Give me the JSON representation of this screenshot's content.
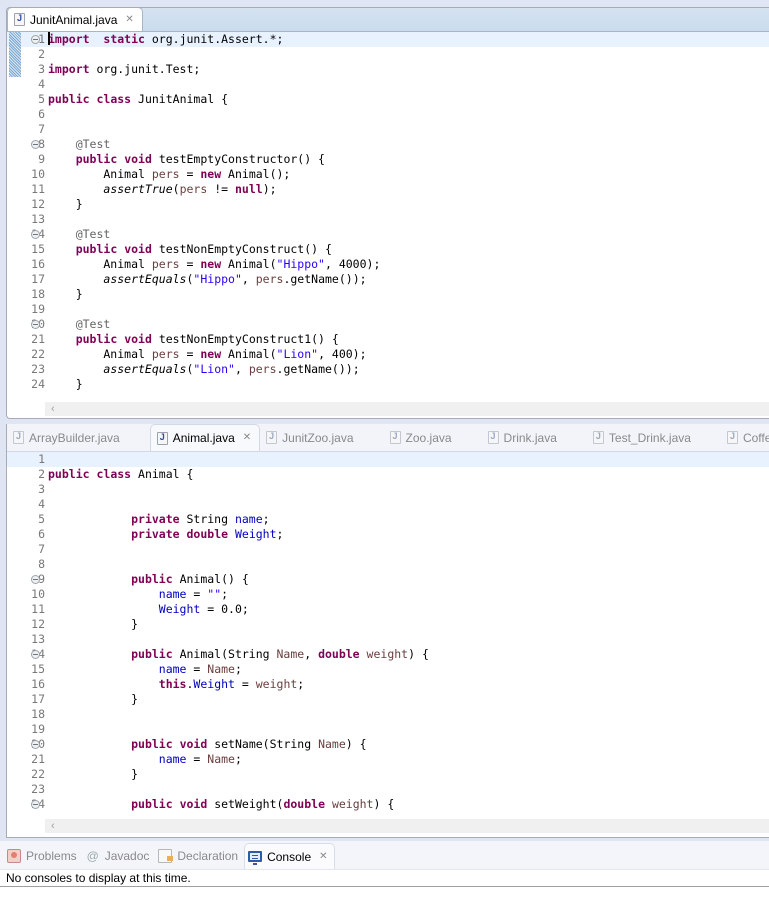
{
  "top_editor": {
    "tabs": [
      {
        "label": "JunitAnimal.java",
        "active": true,
        "closable": true
      }
    ],
    "current_line": 1,
    "lines": [
      {
        "n": "1",
        "fold": true,
        "tokens": [
          [
            "caret",
            ""
          ],
          [
            "kw",
            "import"
          ],
          [
            "",
            "  "
          ],
          [
            "kw",
            "static"
          ],
          [
            "",
            " org.junit.Assert.*;"
          ]
        ]
      },
      {
        "n": "2",
        "tokens": []
      },
      {
        "n": "3",
        "tokens": [
          [
            "kw",
            "import"
          ],
          [
            "",
            " org.junit.Test;"
          ]
        ]
      },
      {
        "n": "4",
        "tokens": []
      },
      {
        "n": "5",
        "tokens": [
          [
            "kw",
            "public"
          ],
          [
            "",
            " "
          ],
          [
            "kw",
            "class"
          ],
          [
            "",
            " JunitAnimal {"
          ]
        ]
      },
      {
        "n": "6",
        "tokens": []
      },
      {
        "n": "7",
        "tokens": []
      },
      {
        "n": "8",
        "fold": true,
        "tokens": [
          [
            "",
            "    "
          ],
          [
            "ann",
            "@Test"
          ]
        ]
      },
      {
        "n": "9",
        "tokens": [
          [
            "",
            "    "
          ],
          [
            "kw",
            "public"
          ],
          [
            "",
            " "
          ],
          [
            "kw",
            "void"
          ],
          [
            "",
            " testEmptyConstructor() {"
          ]
        ]
      },
      {
        "n": "10",
        "tokens": [
          [
            "",
            "        Animal "
          ],
          [
            "local",
            "pers"
          ],
          [
            "",
            " = "
          ],
          [
            "kw",
            "new"
          ],
          [
            "",
            " Animal();"
          ]
        ]
      },
      {
        "n": "11",
        "tokens": [
          [
            "",
            "        "
          ],
          [
            "ital",
            "assertTrue"
          ],
          [
            "",
            "("
          ],
          [
            "local",
            "pers"
          ],
          [
            "",
            " != "
          ],
          [
            "kw",
            "null"
          ],
          [
            "",
            ");"
          ]
        ]
      },
      {
        "n": "12",
        "tokens": [
          [
            "",
            "    }"
          ]
        ]
      },
      {
        "n": "13",
        "tokens": []
      },
      {
        "n": "14",
        "fold": true,
        "tokens": [
          [
            "",
            "    "
          ],
          [
            "ann",
            "@Test"
          ]
        ]
      },
      {
        "n": "15",
        "tokens": [
          [
            "",
            "    "
          ],
          [
            "kw",
            "public"
          ],
          [
            "",
            " "
          ],
          [
            "kw",
            "void"
          ],
          [
            "",
            " testNonEmptyConstruct() {"
          ]
        ]
      },
      {
        "n": "16",
        "tokens": [
          [
            "",
            "        Animal "
          ],
          [
            "local",
            "pers"
          ],
          [
            "",
            " = "
          ],
          [
            "kw",
            "new"
          ],
          [
            "",
            " Animal("
          ],
          [
            "str",
            "\"Hippo\""
          ],
          [
            "",
            ", 4000);"
          ]
        ]
      },
      {
        "n": "17",
        "tokens": [
          [
            "",
            "        "
          ],
          [
            "ital",
            "assertEquals"
          ],
          [
            "",
            "("
          ],
          [
            "str",
            "\"Hippo\""
          ],
          [
            "",
            ", "
          ],
          [
            "local",
            "pers"
          ],
          [
            "",
            ".getName());"
          ]
        ]
      },
      {
        "n": "18",
        "tokens": [
          [
            "",
            "    }"
          ]
        ]
      },
      {
        "n": "19",
        "tokens": []
      },
      {
        "n": "20",
        "fold": true,
        "tokens": [
          [
            "",
            "    "
          ],
          [
            "ann",
            "@Test"
          ]
        ]
      },
      {
        "n": "21",
        "tokens": [
          [
            "",
            "    "
          ],
          [
            "kw",
            "public"
          ],
          [
            "",
            " "
          ],
          [
            "kw",
            "void"
          ],
          [
            "",
            " testNonEmptyConstruct1() {"
          ]
        ]
      },
      {
        "n": "22",
        "tokens": [
          [
            "",
            "        Animal "
          ],
          [
            "local",
            "pers"
          ],
          [
            "",
            " = "
          ],
          [
            "kw",
            "new"
          ],
          [
            "",
            " Animal("
          ],
          [
            "str",
            "\"Lion\""
          ],
          [
            "",
            ", 400);"
          ]
        ]
      },
      {
        "n": "23",
        "tokens": [
          [
            "",
            "        "
          ],
          [
            "ital",
            "assertEquals"
          ],
          [
            "",
            "("
          ],
          [
            "str",
            "\"Lion\""
          ],
          [
            "",
            ", "
          ],
          [
            "local",
            "pers"
          ],
          [
            "",
            ".getName());"
          ]
        ]
      },
      {
        "n": "24",
        "tokens": [
          [
            "",
            "    }"
          ]
        ]
      }
    ],
    "scroll_left_icon": "‹"
  },
  "mid_editor": {
    "tabs": [
      {
        "label": "ArrayBuilder.java",
        "active": false
      },
      {
        "label": "Animal.java",
        "active": true,
        "closable": true
      },
      {
        "label": "JunitZoo.java",
        "active": false
      },
      {
        "label": "Zoo.java",
        "active": false
      },
      {
        "label": "Drink.java",
        "active": false
      },
      {
        "label": "Test_Drink.java",
        "active": false
      },
      {
        "label": "CoffeeSh",
        "active": false
      }
    ],
    "current_line": 1,
    "lines": [
      {
        "n": "1",
        "tokens": []
      },
      {
        "n": "2",
        "tokens": [
          [
            "kw",
            "public"
          ],
          [
            "",
            " "
          ],
          [
            "kw",
            "class"
          ],
          [
            "",
            " Animal {"
          ]
        ]
      },
      {
        "n": "3",
        "tokens": []
      },
      {
        "n": "4",
        "tokens": []
      },
      {
        "n": "5",
        "tokens": [
          [
            "",
            "            "
          ],
          [
            "kw",
            "private"
          ],
          [
            "",
            " String "
          ],
          [
            "field",
            "name"
          ],
          [
            ";"
          ]
        ]
      },
      {
        "n": "6",
        "tokens": [
          [
            "",
            "            "
          ],
          [
            "kw",
            "private"
          ],
          [
            "",
            " "
          ],
          [
            "kw",
            "double"
          ],
          [
            "",
            " "
          ],
          [
            "field",
            "Weight"
          ],
          [
            ";"
          ]
        ]
      },
      {
        "n": "7",
        "tokens": []
      },
      {
        "n": "8",
        "tokens": []
      },
      {
        "n": "9",
        "fold": true,
        "tokens": [
          [
            "",
            "            "
          ],
          [
            "kw",
            "public"
          ],
          [
            "",
            " Animal() {"
          ]
        ]
      },
      {
        "n": "10",
        "tokens": [
          [
            "",
            "                "
          ],
          [
            "field",
            "name"
          ],
          [
            "",
            " = "
          ],
          [
            "str",
            "\"\""
          ],
          [
            ";"
          ]
        ]
      },
      {
        "n": "11",
        "tokens": [
          [
            "",
            "                "
          ],
          [
            "field",
            "Weight"
          ],
          [
            "",
            " = 0.0;"
          ]
        ]
      },
      {
        "n": "12",
        "tokens": [
          [
            "",
            "            }"
          ]
        ]
      },
      {
        "n": "13",
        "tokens": []
      },
      {
        "n": "14",
        "fold": true,
        "tokens": [
          [
            "",
            "            "
          ],
          [
            "kw",
            "public"
          ],
          [
            "",
            " Animal(String "
          ],
          [
            "local",
            "Name"
          ],
          [
            ", "
          ],
          [
            "kw",
            "double"
          ],
          [
            "",
            " "
          ],
          [
            "local",
            "weight"
          ],
          [
            ") {"
          ]
        ]
      },
      {
        "n": "15",
        "tokens": [
          [
            "",
            "                "
          ],
          [
            "field",
            "name"
          ],
          [
            "",
            " = "
          ],
          [
            "local",
            "Name"
          ],
          [
            ";"
          ]
        ]
      },
      {
        "n": "16",
        "tokens": [
          [
            "",
            "                "
          ],
          [
            "kw",
            "this"
          ],
          [
            "",
            "."
          ],
          [
            "field",
            "Weight"
          ],
          [
            "",
            " = "
          ],
          [
            "local",
            "weight"
          ],
          [
            ";"
          ]
        ]
      },
      {
        "n": "17",
        "tokens": [
          [
            "",
            "            }"
          ]
        ]
      },
      {
        "n": "18",
        "tokens": []
      },
      {
        "n": "19",
        "tokens": []
      },
      {
        "n": "20",
        "fold": true,
        "tokens": [
          [
            "",
            "            "
          ],
          [
            "kw",
            "public"
          ],
          [
            "",
            " "
          ],
          [
            "kw",
            "void"
          ],
          [
            "",
            " setName(String "
          ],
          [
            "local",
            "Name"
          ],
          [
            ") {"
          ]
        ]
      },
      {
        "n": "21",
        "tokens": [
          [
            "",
            "                "
          ],
          [
            "field",
            "name"
          ],
          [
            "",
            " = "
          ],
          [
            "local",
            "Name"
          ],
          [
            ";"
          ]
        ]
      },
      {
        "n": "22",
        "tokens": [
          [
            "",
            "            }"
          ]
        ]
      },
      {
        "n": "23",
        "tokens": []
      },
      {
        "n": "24",
        "fold": true,
        "tokens": [
          [
            "",
            "            "
          ],
          [
            "kw",
            "public"
          ],
          [
            "",
            " "
          ],
          [
            "kw",
            "void"
          ],
          [
            "",
            " setWeight("
          ],
          [
            "kw",
            "double"
          ],
          [
            "",
            " "
          ],
          [
            "local",
            "weight"
          ],
          [
            ") {"
          ]
        ]
      }
    ],
    "scroll_left_icon": "‹"
  },
  "bottom_panel": {
    "tabs": [
      {
        "label": "Problems",
        "icon": "problems-icon",
        "active": false
      },
      {
        "label": "Javadoc",
        "icon": "javadoc-icon",
        "active": false
      },
      {
        "label": "Declaration",
        "icon": "declaration-icon",
        "active": false
      },
      {
        "label": "Console",
        "icon": "console-icon",
        "active": true,
        "closable": true
      }
    ],
    "message": "No consoles to display at this time."
  },
  "icons": {
    "close": "✕",
    "javadoc": "@"
  },
  "colors": {
    "keyword": "#7f0055",
    "string": "#2a00ff",
    "field": "#0000c0",
    "annotation": "#646464",
    "local_var": "#6a3e3e",
    "current_line": "#e8f2fe"
  }
}
